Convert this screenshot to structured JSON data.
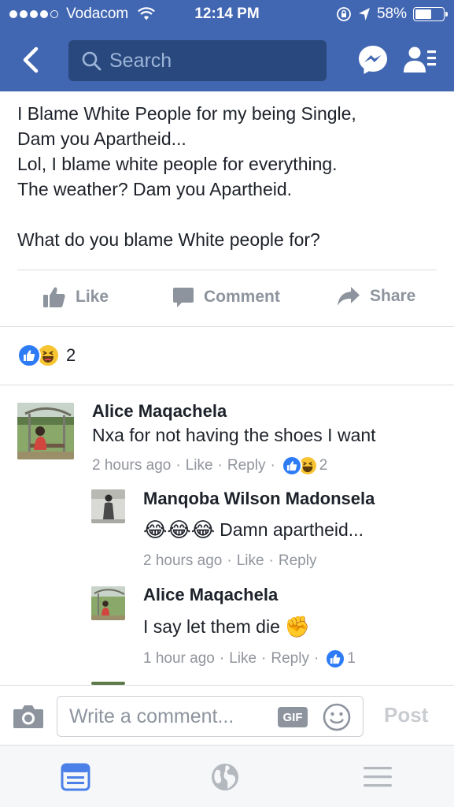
{
  "status_bar": {
    "carrier": "Vodacom",
    "time": "12:14 PM",
    "battery": "58%",
    "battery_level": 0.58
  },
  "nav": {
    "search_placeholder": "Search",
    "icons": [
      "back-arrow-icon",
      "search-icon",
      "messenger-icon",
      "friend-requests-icon"
    ]
  },
  "post": {
    "lines": [
      "I Blame White People for my being Single,",
      "Dam you Apartheid...",
      "Lol, I blame white people for everything.",
      "The weather? Dam you Apartheid.",
      "",
      "What do you blame White people for?"
    ],
    "actions": {
      "like": "Like",
      "comment": "Comment",
      "share": "Share"
    },
    "reaction_count": "2"
  },
  "comments": [
    {
      "author": "Alice Maqachela",
      "text": "Nxa for not having the shoes I want",
      "time": "2 hours ago",
      "like": "Like",
      "reply": "Reply",
      "reaction_count": "2"
    },
    {
      "author": "Manqoba Wilson Madonsela",
      "text": "Damn apartheid...",
      "emoji": "😂😂😂",
      "time": "2 hours ago",
      "like": "Like",
      "reply": "Reply"
    },
    {
      "author": "Alice Maqachela",
      "text": "I say let them die",
      "emoji": "✊",
      "time": "1 hour ago",
      "like": "Like",
      "reply": "Reply",
      "reaction_count": "1"
    }
  ],
  "composer": {
    "placeholder": "Write a comment...",
    "gif_label": "GIF",
    "post_label": "Post"
  },
  "colors": {
    "brand": "#4267b2",
    "search_bg": "#29487d",
    "like_blue": "#2e7bf6",
    "haha_yellow": "#f7c531",
    "muted_text": "#90949c",
    "tab_active": "#4a80e8"
  }
}
